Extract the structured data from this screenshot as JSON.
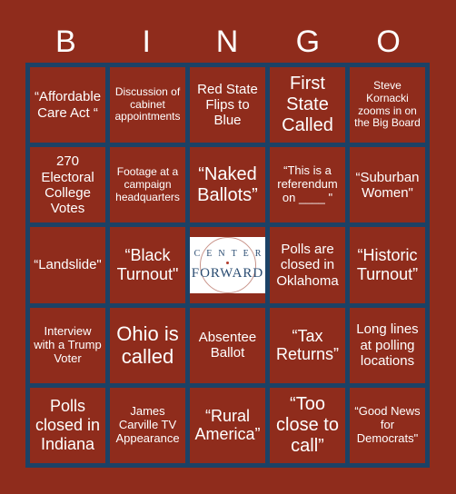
{
  "header": {
    "letters": [
      "B",
      "I",
      "N",
      "G",
      "O"
    ]
  },
  "colors": {
    "background": "#8f2c1c",
    "grid_lines": "#1c4266",
    "text": "#ffffff"
  },
  "free_space": {
    "logo_top": "CENTER",
    "logo_bottom": "FORWARD"
  },
  "rows": [
    [
      "“Affordable Care Act “",
      "Discussion of cabinet appointments",
      "Red State Flips to Blue",
      "First State Called",
      "Steve Kornacki zooms in on the Big Board"
    ],
    [
      "270 Electoral College Votes",
      "Footage at a campaign headquarters",
      "“Naked Ballots”",
      "“This is a referendum on ____ \"",
      "“Suburban Women\""
    ],
    [
      "“Landslide\"",
      "“Black Turnout\"",
      "",
      "Polls are closed in Oklahoma",
      "“Historic Turnout”"
    ],
    [
      "Interview with a Trump Voter",
      "Ohio is called",
      "Absentee Ballot",
      "“Tax Returns”",
      "Long lines at polling locations"
    ],
    [
      "Polls closed in Indiana",
      "James Carville TV Appearance",
      "“Rural America”",
      "“Too close to call”",
      "“Good News for Democrats\""
    ]
  ]
}
